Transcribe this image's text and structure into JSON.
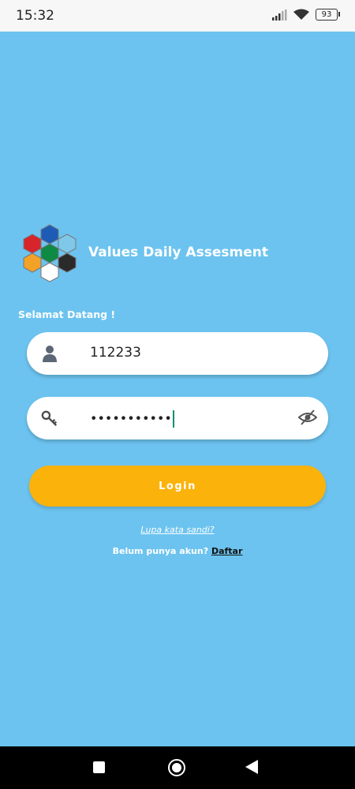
{
  "status_bar": {
    "time": "15:32",
    "battery": "93"
  },
  "app": {
    "title": "Values Daily Assesment",
    "welcome": "Selamat Datang !",
    "logo_colors": [
      "#1e5bb5",
      "#d8242b",
      "#7fc8ea",
      "#0e8a45",
      "#f2a227",
      "#2a2a2a",
      "#ffffff"
    ]
  },
  "form": {
    "username_value": "112233",
    "password_value": "•••••••••••",
    "login_label": "Login",
    "forgot_label": "Lupa kata sandi?",
    "signup_prompt": "Belum punya akun?",
    "signup_link": "Daftar"
  },
  "icons": {
    "username": "user-icon",
    "password": "key-icon",
    "toggle": "eye-off-icon"
  },
  "colors": {
    "background": "#6cc3ef",
    "button": "#fbb20a"
  }
}
